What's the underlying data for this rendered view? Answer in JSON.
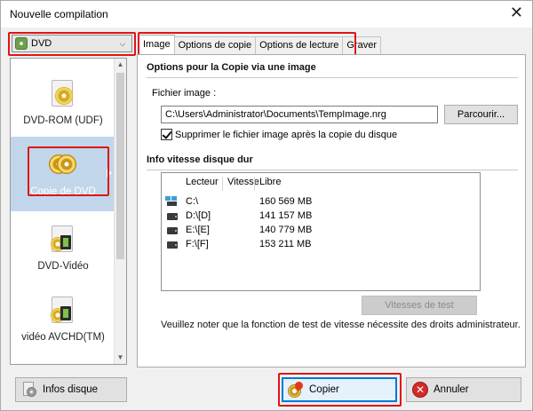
{
  "window": {
    "title": "Nouvelle compilation",
    "close_glyph": "✕"
  },
  "left": {
    "dropdown_value": "DVD",
    "dropdown_icon": "dvd-disc-icon",
    "items": [
      {
        "label": "DVD-ROM (UDF)",
        "icon": "dvd-rom-icon",
        "selected": false
      },
      {
        "label": "Copie de DVD",
        "icon": "copy-dvd-icon",
        "selected": true
      },
      {
        "label": "DVD-Vidéo",
        "icon": "dvd-video-icon",
        "selected": false
      },
      {
        "label": "vidéo AVCHD(TM)",
        "icon": "avchd-video-icon",
        "selected": false
      }
    ]
  },
  "tabs": [
    {
      "label": "Image",
      "active": true
    },
    {
      "label": "Options de copie",
      "active": false
    },
    {
      "label": "Options de lecture",
      "active": false
    },
    {
      "label": "Graver",
      "active": false
    }
  ],
  "image_tab": {
    "section1_title": "Options pour la Copie via une image",
    "file_label": "Fichier image :",
    "file_value": "C:\\Users\\Administrator\\Documents\\TempImage.nrg",
    "browse_button": "Parcourir...",
    "delete_checkbox_label": "Supprimer le fichier image après la copie du disque",
    "delete_checked": true,
    "section2_title": "Info vitesse disque dur",
    "columns": [
      "Lecteur",
      "Vitesse",
      "Libre"
    ],
    "drives": [
      {
        "reader": "C:\\",
        "speed": "",
        "free": "160 569 MB",
        "icon": "network-drive-icon"
      },
      {
        "reader": "D:\\[D]",
        "speed": "",
        "free": "141 157 MB",
        "icon": "hard-drive-icon"
      },
      {
        "reader": "E:\\[E]",
        "speed": "",
        "free": "140 779 MB",
        "icon": "hard-drive-icon"
      },
      {
        "reader": "F:\\[F]",
        "speed": "",
        "free": "153 211 MB",
        "icon": "hard-drive-icon"
      }
    ],
    "speed_test_button": "Vitesses de test",
    "note": "Veuillez noter que la fonction de test de vitesse nécessite des droits administrateur."
  },
  "bottom": {
    "info_button": "Infos disque",
    "copy_button": "Copier",
    "cancel_button": "Annuler"
  },
  "highlight_color": "#e01414"
}
